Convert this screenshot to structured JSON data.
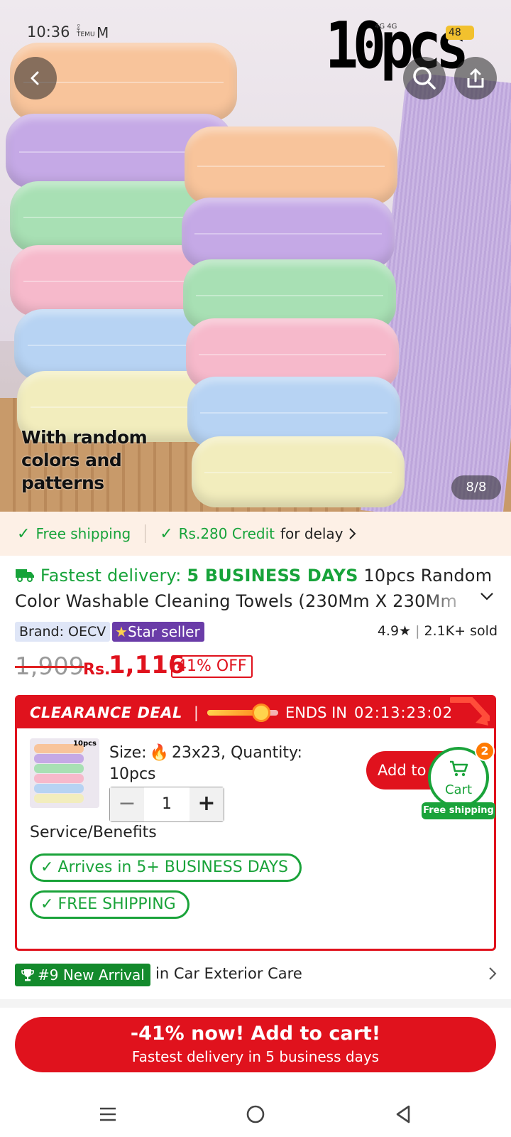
{
  "status_bar": {
    "time": "10:36",
    "mini_app_line1": "နိ",
    "mini_app_line2": "TEMU",
    "mail_glyph": "M",
    "network": "4G 4G",
    "battery": "48"
  },
  "hero": {
    "badge_text": "10pcs",
    "caption": "With random\ncolors and\npatterns",
    "counter": "8/8"
  },
  "benefits": {
    "free_shipping": "Free shipping",
    "credit": "Rs.280 Credit",
    "credit_suffix": "for delay"
  },
  "product": {
    "fast_label": "Fastest delivery: ",
    "fast_days": "5 BUSINESS DAYS",
    "title_line1_rest": " 10pcs Random",
    "title_line2": "Color Washable Cleaning Towels (230Mm X 230Mm",
    "brand": "Brand: OECV",
    "star_seller": "Star seller",
    "rating": "4.9",
    "sold": "2.1K+ sold",
    "old_price": "1,909",
    "currency": "Rs.",
    "price": "1,116",
    "discount": "41% OFF"
  },
  "clearance": {
    "title": "CLEARANCE DEAL",
    "pipe": "|",
    "progress": 0.76,
    "ends_label": "ENDS IN",
    "timer": "02:13:23:02",
    "thumb_tag": "10pcs",
    "size_label": "Size:",
    "size_value": "23x23, Quantity:",
    "size_line2": "10pcs",
    "qty_minus": "−",
    "qty_value": "1",
    "qty_plus": "+",
    "add_label": "Add to cart",
    "cart_label": "Cart",
    "cart_count": "2",
    "cart_ship": "Free shipping",
    "service_title": "Service/Benefits",
    "pill_arrives": "Arrives in 5+ BUSINESS DAYS",
    "pill_shipping": "FREE SHIPPING"
  },
  "ranking": {
    "badge": "#9 New Arrival",
    "category": "in Car Exterior Care"
  },
  "cta": {
    "main": "-41% now! Add to cart!",
    "sub": "Fastest delivery in 5 business days"
  },
  "colors": {
    "accent_red": "#e0121d",
    "green": "#17a33a",
    "star_purple": "#6a3ca8"
  }
}
